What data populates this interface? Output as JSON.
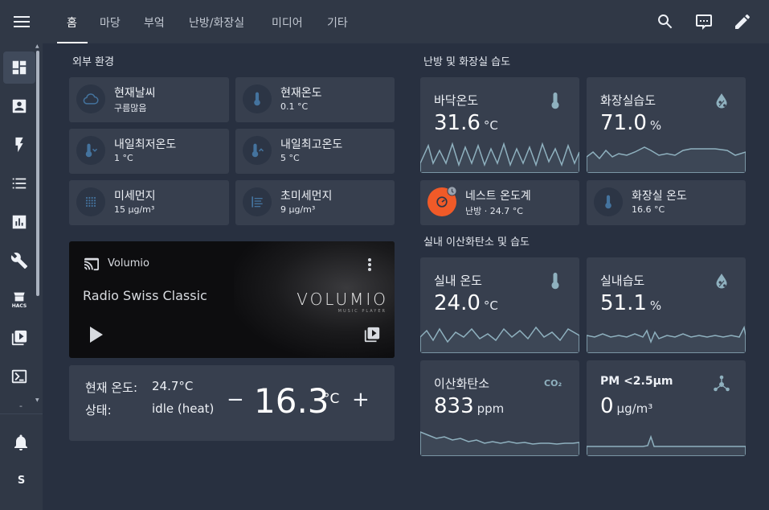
{
  "header": {
    "tabs": [
      {
        "label": "홈",
        "active": true
      },
      {
        "label": "마당"
      },
      {
        "label": "부엌"
      },
      {
        "label": "난방/화장실"
      },
      {
        "label": "미디어"
      },
      {
        "label": "기타"
      }
    ],
    "icons": [
      "search-icon",
      "assist-chat-icon",
      "edit-pencil-icon"
    ]
  },
  "sidebar": {
    "items": [
      "dashboard-icon",
      "account-box-icon",
      "lightning-icon",
      "list-icon",
      "chart-icon",
      "wrench-icon",
      "hacs-icon",
      "playlist-icon",
      "terminal-icon"
    ],
    "hacs_label": "HACS",
    "separator": "-",
    "user_initial": "S"
  },
  "outdoor": {
    "title": "외부 환경",
    "tiles": [
      {
        "name": "현재날씨",
        "value": "구름많음",
        "icon": "cloud-icon"
      },
      {
        "name": "현재온도",
        "value": "0.1 °C",
        "icon": "thermometer-icon"
      },
      {
        "name": "내일최저온도",
        "value": "1 °C",
        "icon": "thermometer-low-icon"
      },
      {
        "name": "내일최고온도",
        "value": "5 °C",
        "icon": "thermometer-high-icon"
      },
      {
        "name": "미세먼지",
        "value": "15 µg/m³",
        "icon": "dots-grid-icon"
      },
      {
        "name": "초미세먼지",
        "value": "9 µg/m³",
        "icon": "fine-dust-icon"
      }
    ]
  },
  "media": {
    "source": "Volumio",
    "title": "Radio Swiss Classic",
    "brand": "VOLUMIO",
    "brand_sub": "MUSIC PLAYER"
  },
  "thermostat": {
    "current_label": "현재 온도:",
    "current_value": "24.7°C",
    "state_label": "상태:",
    "state_value": "idle (heat)",
    "minus": "−",
    "target": "16.3",
    "unit": "°C",
    "plus": "+"
  },
  "heating": {
    "title": "난방 및 화장실 습도",
    "cards": [
      {
        "name": "바닥온도",
        "value": "31.6",
        "unit": "°C",
        "icon": "thermometer-icon"
      },
      {
        "name": "화장실습도",
        "value": "71.0",
        "unit": "%",
        "icon": "water-percent-icon"
      }
    ],
    "tiles": [
      {
        "name": "네스트 온도계",
        "value": "난방 · 24.7 °C",
        "icon": "nest-thermostat-icon"
      },
      {
        "name": "화장실 온도",
        "value": "16.6 °C",
        "icon": "thermometer-icon"
      }
    ]
  },
  "indoor": {
    "title": "실내 이산화탄소 및 습도",
    "cards": [
      {
        "name": "실내 온도",
        "value": "24.0",
        "unit": "°C",
        "icon": "thermometer-icon"
      },
      {
        "name": "실내습도",
        "value": "51.1",
        "unit": "%",
        "icon": "water-percent-icon"
      },
      {
        "name": "이산화탄소",
        "value": "833",
        "unit": "ppm",
        "icon": "co2-icon",
        "icon_text": "CO₂"
      },
      {
        "name": "PM <2.5µm",
        "value": "0",
        "unit": "µg/m³",
        "icon": "molecule-icon"
      }
    ]
  },
  "colors": {
    "background": "#283040",
    "card": "#373f4e",
    "sparkline": "#8fb1bf",
    "icon_blue": "#44739e",
    "nest_orange": "#f05a28"
  }
}
